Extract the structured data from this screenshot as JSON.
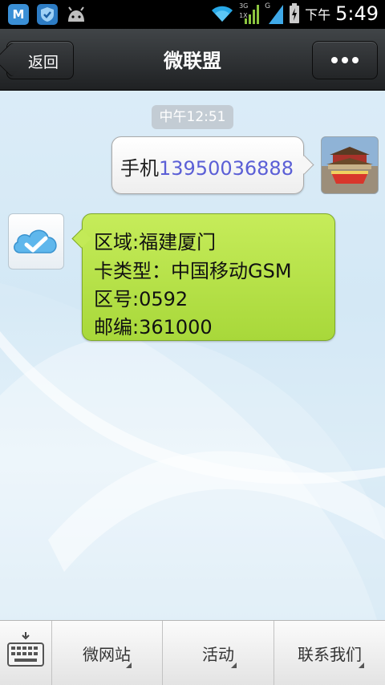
{
  "status_bar": {
    "ampm": "下午",
    "time": "5:49",
    "notification_icons": [
      "m-app-icon",
      "shield-app-icon",
      "android-icon"
    ],
    "system_icons": [
      "wifi-icon",
      "signal-3g-icon",
      "signal-g-icon",
      "battery-charging-icon"
    ],
    "network_3g": "3G",
    "network_1x": "1X",
    "network_g": "G"
  },
  "header": {
    "back_label": "返回",
    "title": "微联盟",
    "more_icon": "more-dots-icon"
  },
  "chat": {
    "timestamp": "中午12:51",
    "messages": [
      {
        "side": "right",
        "label": "手机",
        "number": "13950036888",
        "number_color": "#5b5fd6",
        "avatar": "palace-photo-avatar"
      },
      {
        "side": "left",
        "avatar": "cloud-check-avatar",
        "lines": [
          "区域:福建厦门",
          "卡类型：中国移动GSM",
          "区号:0592",
          "邮编:361000"
        ]
      }
    ]
  },
  "bottom_bar": {
    "keyboard_icon": "keyboard-icon",
    "items": [
      {
        "label": "微网站"
      },
      {
        "label": "活动"
      },
      {
        "label": "联系我们"
      }
    ]
  },
  "colors": {
    "bubble_right": "#ffffff",
    "bubble_left": "#b5e04a",
    "header": "#2a2c2e"
  }
}
